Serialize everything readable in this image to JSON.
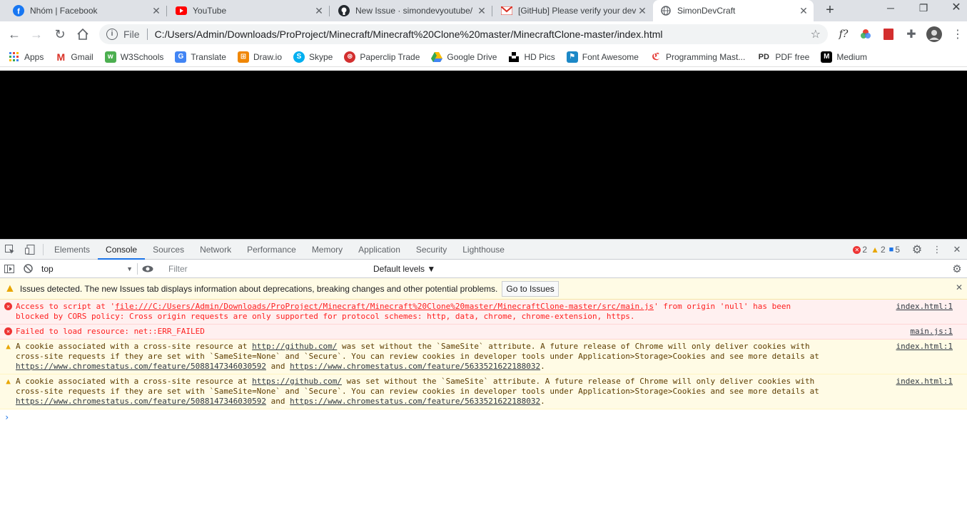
{
  "tabs": [
    {
      "title": "Nhóm | Facebook",
      "icon": "facebook-icon",
      "color": "#1877f2"
    },
    {
      "title": "YouTube",
      "icon": "youtube-icon",
      "color": "#ff0000"
    },
    {
      "title": "New Issue · simondevyoutube/",
      "icon": "github-icon",
      "color": "#24292e"
    },
    {
      "title": "[GitHub] Please verify your dev",
      "icon": "gmail-icon",
      "color": "#d93025"
    },
    {
      "title": "SimonDevCraft",
      "icon": "globe-icon",
      "color": "#5f6368"
    }
  ],
  "omnibox": {
    "scheme": "File",
    "url": "C:/Users/Admin/Downloads/ProProject/Minecraft/Minecraft%20Clone%20master/MinecraftClone-master/index.html"
  },
  "bookmarks": [
    {
      "label": "Apps",
      "icon": "apps-grid-icon",
      "color": "#4285f4"
    },
    {
      "label": "Gmail",
      "icon": "gmail-icon",
      "color": "#d93025"
    },
    {
      "label": "W3Schools",
      "icon": "w3schools-icon",
      "color": "#4caf50"
    },
    {
      "label": "Translate",
      "icon": "translate-icon",
      "color": "#4285f4"
    },
    {
      "label": "Draw.io",
      "icon": "drawio-icon",
      "color": "#f08705"
    },
    {
      "label": "Skype",
      "icon": "skype-icon",
      "color": "#00aff0"
    },
    {
      "label": "Paperclip Trade",
      "icon": "paperclip-icon",
      "color": "#d32f2f"
    },
    {
      "label": "Google Drive",
      "icon": "google-drive-icon",
      "color": "#fbbc04"
    },
    {
      "label": "HD Pics",
      "icon": "unsplash-icon",
      "color": "#000000"
    },
    {
      "label": "Font Awesome",
      "icon": "font-awesome-icon",
      "color": "#1c88c7"
    },
    {
      "label": "Programming Mast...",
      "icon": "programming-icon",
      "color": "#e53935"
    },
    {
      "label": "PDF free",
      "icon": "pdf-icon",
      "color": "#333333"
    },
    {
      "label": "Medium",
      "icon": "medium-icon",
      "color": "#000000"
    }
  ],
  "devtools": {
    "tabs": [
      "Elements",
      "Console",
      "Sources",
      "Network",
      "Performance",
      "Memory",
      "Application",
      "Security",
      "Lighthouse"
    ],
    "active_tab": "Console",
    "counts": {
      "errors": "2",
      "warnings": "2",
      "info": "5"
    },
    "context": "top",
    "filter_placeholder": "Filter",
    "levels": "Default levels ▼",
    "issues_text": "Issues detected. The new Issues tab displays information about deprecations, breaking changes and other potential problems.",
    "issues_button": "Go to Issues",
    "messages": [
      {
        "level": "error",
        "pre": "Access to script at '",
        "link": "file:///C:/Users/Admin/Downloads/ProProject/Minecraft/Minecraft%20Clone%20master/MinecraftClone-master/src/main.js",
        "post": "' from origin 'null' has been blocked by CORS policy: Cross origin requests are only supported for protocol schemes: http, data, chrome, chrome-extension, https.",
        "source": "index.html:1"
      },
      {
        "level": "error",
        "pre": "Failed to load resource: net::ERR_FAILED",
        "link": "",
        "post": "",
        "source": "main.js:1"
      },
      {
        "level": "warning",
        "pre": "A cookie associated with a cross-site resource at ",
        "link": "http://github.com/",
        "post": " was set without the `SameSite` attribute. A future release of Chrome will only deliver cookies with cross-site requests if they are set with `SameSite=None` and `Secure`. You can review cookies in developer tools under Application>Storage>Cookies and see more details at ",
        "link2": "https://www.chromestatus.com/feature/5088147346030592",
        "mid": " and ",
        "link3": "https://www.chromestatus.com/feature/5633521622188032",
        "end": ".",
        "source": "index.html:1"
      },
      {
        "level": "warning",
        "pre": "A cookie associated with a cross-site resource at ",
        "link": "https://github.com/",
        "post": " was set without the `SameSite` attribute. A future release of Chrome will only deliver cookies with cross-site requests if they are set with `SameSite=None` and `Secure`. You can review cookies in developer tools under Application>Storage>Cookies and see more details at ",
        "link2": "https://www.chromestatus.com/feature/5088147346030592",
        "mid": " and ",
        "link3": "https://www.chromestatus.com/feature/5633521622188032",
        "end": ".",
        "source": "index.html:1"
      }
    ],
    "prompt": "›"
  }
}
